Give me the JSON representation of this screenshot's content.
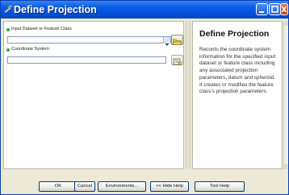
{
  "window": {
    "title": "Define Projection",
    "title_icon": "hammer-tool-icon",
    "buttons": [
      "minimize-icon",
      "maximize-icon",
      "close-icon"
    ]
  },
  "params": {
    "input": {
      "label": "Input Dataset or Feature Class",
      "value": "",
      "open_icon": "open-folder-icon",
      "dropdown_icon": "chevron-down-icon"
    },
    "coord": {
      "label": "Coordinate System",
      "value": "",
      "props_icon": "properties-icon"
    },
    "required_color": "#2fa83a"
  },
  "help": {
    "title": "Define Projection",
    "body": "Records the coordinate system information for the specified input dataset or feature class including any associated projection parameters, datum and spheroid. It creates or modifies the feature class's projection parameters."
  },
  "buttons": {
    "ok": "OK",
    "cancel": "Cancel",
    "environments": "Environments...",
    "hide_help": "<< Hide Help",
    "tool_help": "Tool Help"
  },
  "colors": {
    "titlebar": "#0c5ce8",
    "close": "#c0401c",
    "dialog_bg": "#ece9d8"
  }
}
